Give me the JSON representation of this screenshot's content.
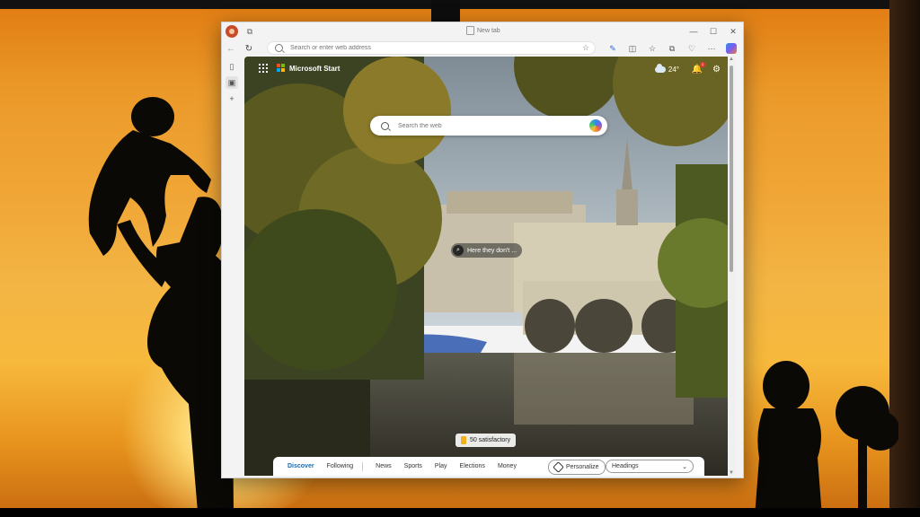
{
  "browser": {
    "tab_title": "New tab",
    "address_placeholder": "Search or enter web address"
  },
  "new_tab": {
    "brand": "Microsoft Start",
    "weather_temp": "24°",
    "notifications_count": "1",
    "search_placeholder": "Search the web",
    "image_caption": "Here they don't ...",
    "promo_label": "50 satisfactory"
  },
  "feed_nav": {
    "tabs": [
      "Discover",
      "Following",
      "News",
      "Sports",
      "Play",
      "Elections",
      "Money"
    ],
    "personalize_label": "Personalize",
    "layout_select": "Headings"
  },
  "icons": {
    "addr_favorite": "☆",
    "bell": "🔔",
    "gear": "⚙"
  },
  "colors": {
    "accent": "#0f6cbd",
    "badge": "#e5382e"
  }
}
